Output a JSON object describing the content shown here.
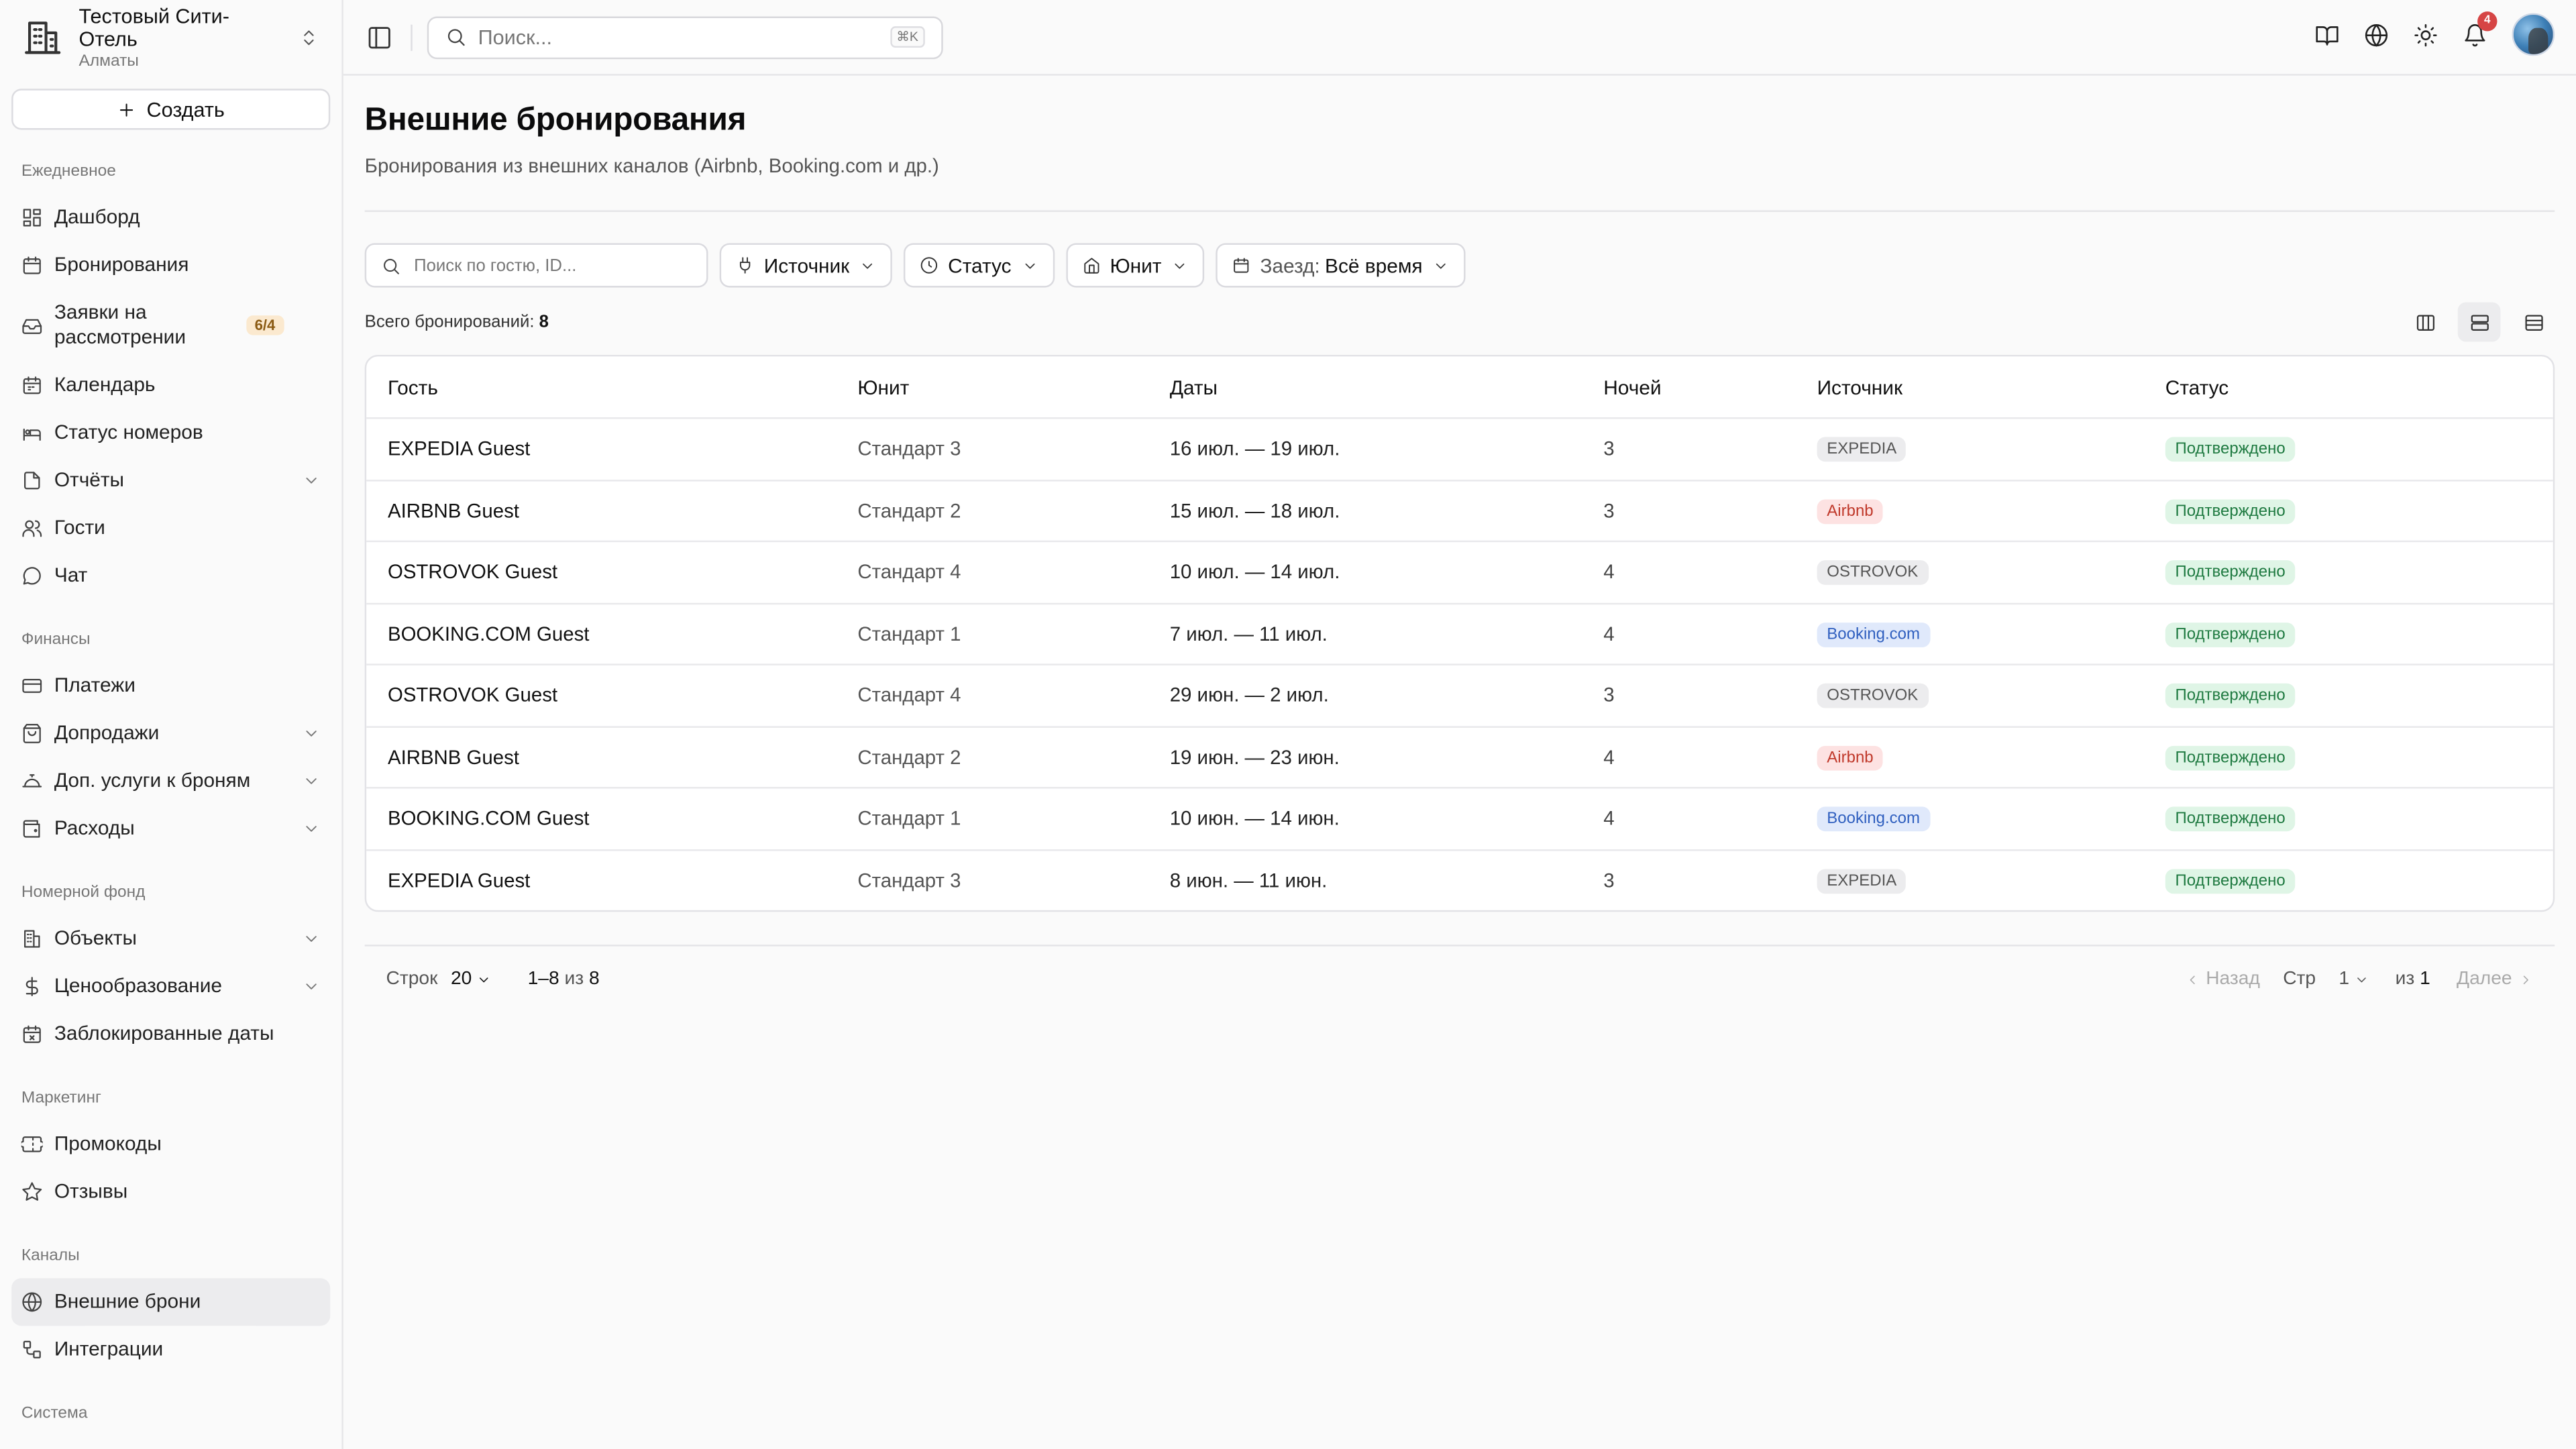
{
  "hotel": {
    "name": "Тестовый Сити-Отель",
    "city": "Алматы"
  },
  "sidebar": {
    "create_label": "Создать",
    "sections": {
      "daily": "Ежедневное",
      "finance": "Финансы",
      "rooms": "Номерной фонд",
      "marketing": "Маркетинг",
      "channels": "Каналы",
      "system": "Система"
    },
    "items": {
      "dashboard": "Дашборд",
      "bookings": "Бронирования",
      "requests": "Заявки на рассмотрении",
      "requests_badge": "6/4",
      "calendar": "Календарь",
      "room_status": "Статус номеров",
      "reports": "Отчёты",
      "guests": "Гости",
      "chat": "Чат",
      "payments": "Платежи",
      "upsells": "Допродажи",
      "extra_services": "Доп. услуги к броням",
      "expenses": "Расходы",
      "properties": "Объекты",
      "pricing": "Ценообразование",
      "blocked_dates": "Заблокированные даты",
      "promo": "Промокоды",
      "reviews": "Отзывы",
      "external": "Внешние брони",
      "integrations": "Интеграции"
    }
  },
  "topbar": {
    "search_placeholder": "Поиск...",
    "shortcut": "⌘K",
    "notifications_count": "4"
  },
  "page": {
    "title": "Внешние бронирования",
    "subtitle": "Бронирования из внешних каналов (Airbnb, Booking.com и др.)"
  },
  "filters": {
    "search_placeholder": "Поиск по гостю, ID...",
    "source": "Источник",
    "status": "Статус",
    "unit": "Юнит",
    "checkin_label": "Заезд:",
    "checkin_value": "Всё время"
  },
  "total": {
    "label": "Всего бронирований:",
    "value": "8"
  },
  "table": {
    "headers": {
      "guest": "Гость",
      "unit": "Юнит",
      "dates": "Даты",
      "nights": "Ночей",
      "source": "Источник",
      "status": "Статус"
    },
    "rows": [
      {
        "guest": "EXPEDIA Guest",
        "unit": "Стандарт 3",
        "dates": "16 июл. — 19 июл.",
        "nights": "3",
        "source": "EXPEDIA",
        "status": "Подтверждено"
      },
      {
        "guest": "AIRBNB Guest",
        "unit": "Стандарт 2",
        "dates": "15 июл. — 18 июл.",
        "nights": "3",
        "source": "Airbnb",
        "status": "Подтверждено"
      },
      {
        "guest": "OSTROVOK Guest",
        "unit": "Стандарт 4",
        "dates": "10 июл. — 14 июл.",
        "nights": "4",
        "source": "OSTROVOK",
        "status": "Подтверждено"
      },
      {
        "guest": "BOOKING.COM Guest",
        "unit": "Стандарт 1",
        "dates": "7 июл. — 11 июл.",
        "nights": "4",
        "source": "Booking.com",
        "status": "Подтверждено"
      },
      {
        "guest": "OSTROVOK Guest",
        "unit": "Стандарт 4",
        "dates": "29 июн. — 2 июл.",
        "nights": "3",
        "source": "OSTROVOK",
        "status": "Подтверждено"
      },
      {
        "guest": "AIRBNB Guest",
        "unit": "Стандарт 2",
        "dates": "19 июн. — 23 июн.",
        "nights": "4",
        "source": "Airbnb",
        "status": "Подтверждено"
      },
      {
        "guest": "BOOKING.COM Guest",
        "unit": "Стандарт 1",
        "dates": "10 июн. — 14 июн.",
        "nights": "4",
        "source": "Booking.com",
        "status": "Подтверждено"
      },
      {
        "guest": "EXPEDIA Guest",
        "unit": "Стандарт 3",
        "dates": "8 июн. — 11 июн.",
        "nights": "3",
        "source": "EXPEDIA",
        "status": "Подтверждено"
      }
    ]
  },
  "pager": {
    "rows_label": "Строк",
    "rows_value": "20",
    "range_a": "1–8",
    "range_of": "из",
    "range_b": "8",
    "prev": "Назад",
    "page_label": "Стр",
    "page_value": "1",
    "of_label": "из",
    "of_value": "1",
    "next": "Далее"
  },
  "colors": {
    "accent_green": "#1f7a41",
    "airbnb_red": "#c0392b",
    "booking_blue": "#2f5fbf",
    "notif_red": "#d64545"
  }
}
